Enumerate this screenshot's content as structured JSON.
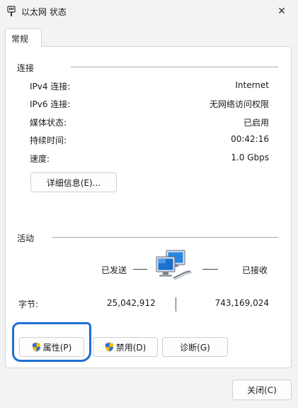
{
  "window": {
    "title": "以太网 状态",
    "close_glyph": "✕"
  },
  "tabs": [
    {
      "label": "常规"
    }
  ],
  "connection": {
    "title": "连接",
    "rows": [
      {
        "label": "IPv4 连接:",
        "value": "Internet"
      },
      {
        "label": "IPv6 连接:",
        "value": "无网络访问权限"
      },
      {
        "label": "媒体状态:",
        "value": "已启用"
      },
      {
        "label": "持续时间:",
        "value": "00:42:16"
      },
      {
        "label": "速度:",
        "value": "1.0 Gbps"
      }
    ],
    "details_button": "详细信息(E)..."
  },
  "activity": {
    "title": "活动",
    "sent_label": "已发送",
    "received_label": "已接收",
    "bytes_label": "字节:",
    "bytes_sent": "25,042,912",
    "bytes_received": "743,169,024",
    "network_icon": "network-computers-icon"
  },
  "buttons": {
    "properties": "属性(P)",
    "disable": "禁用(D)",
    "diagnose": "诊断(G)",
    "close": "关闭(C)"
  },
  "colors": {
    "highlight": "#1e6fd0",
    "shield_blue": "#2a6fd6",
    "shield_yellow": "#f2c200"
  }
}
